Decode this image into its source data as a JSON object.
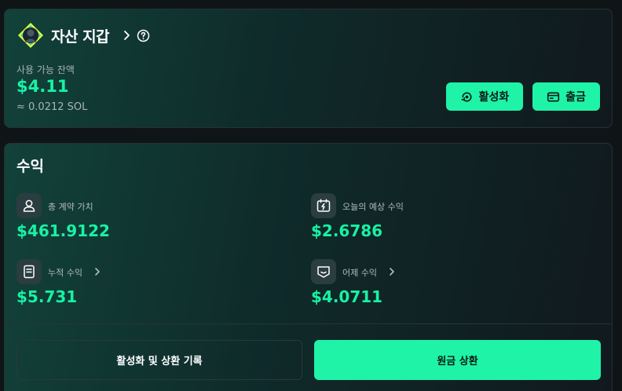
{
  "wallet": {
    "title": "자산 지갑",
    "balance_label": "사용 가능 잔액",
    "balance_usd": "$4.11",
    "balance_sol": "≈ 0.0212 SOL",
    "activate_label": "활성화",
    "withdraw_label": "출금"
  },
  "earnings": {
    "title": "수익",
    "stats": [
      {
        "label": "총 계약 가치",
        "value": "$461.9122",
        "icon": "user-icon"
      },
      {
        "label": "오늘의 예상 수익",
        "value": "$2.6786",
        "icon": "calendar-bolt-icon"
      },
      {
        "label": "누적 수익",
        "value": "$5.731",
        "icon": "document-icon"
      },
      {
        "label": "어제 수익",
        "value": "$4.0711",
        "icon": "inbox-icon"
      }
    ],
    "history_label": "활성화 및 상환 기록",
    "principal_label": "원금 상환"
  },
  "colors": {
    "accent": "#1ff3a8",
    "value_green": "#17f2a5",
    "background": "#0f1417",
    "card_gradient_start": "#12423a"
  }
}
